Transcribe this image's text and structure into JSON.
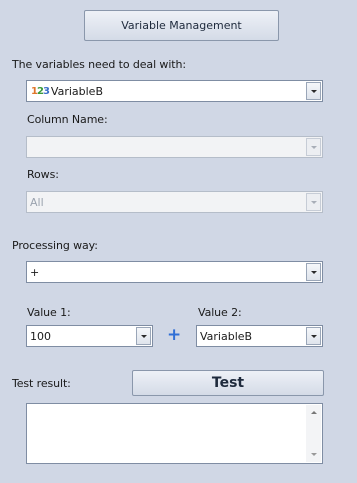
{
  "header": {
    "button_label": "Variable Management"
  },
  "variables": {
    "label": "The variables need to deal with:",
    "selected": "VariableB",
    "icon_digits": [
      "1",
      "2",
      "3"
    ]
  },
  "column_name": {
    "label": "Column Name:",
    "value": ""
  },
  "rows": {
    "label": "Rows:",
    "value": "All"
  },
  "processing": {
    "label": "Processing way:",
    "value": "+"
  },
  "value1": {
    "label": "Value 1:",
    "value": "100"
  },
  "operator_symbol": "+",
  "value2": {
    "label": "Value 2:",
    "value": "VariableB"
  },
  "test": {
    "result_label": "Test result:",
    "button_label": "Test",
    "result_text": ""
  },
  "colors": {
    "background": "#d0d7e5",
    "operator": "#2f6fd6"
  }
}
